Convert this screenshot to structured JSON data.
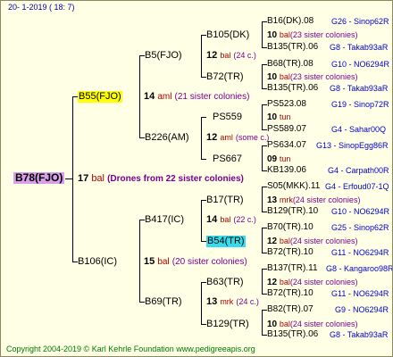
{
  "date_label": "20-   1-2019  (  18:   7)",
  "footer": "Copyright 2004-2019 © Karl Kehrle Foundation     www.pedigreeapis.org",
  "queen": {
    "id": "B78(FJO)",
    "value": "17",
    "unit": "bal",
    "note": "(Drones from 22 sister colonies)"
  },
  "sire": {
    "id": "B55(FJO)",
    "value": "14",
    "unit": "aml",
    "note": "(21 sister colonies)"
  },
  "dam": {
    "id": "B106(IC)",
    "value": "15",
    "unit": "bal",
    "note": "(20 sister colonies)"
  },
  "gen3": [
    {
      "id": "B5(FJO)",
      "value": "12",
      "unit": "bal",
      "note": "(24 c.)"
    },
    {
      "id": "B226(AM)",
      "value": "12",
      "unit": "aml",
      "note": "(some c.)"
    },
    {
      "id": "B417(IC)",
      "value": "14",
      "unit": "bal",
      "note": "(22 c.)"
    },
    {
      "id": "B69(TR)",
      "value": "13",
      "unit": "mrk",
      "note": "(24 c.)"
    }
  ],
  "gen4": [
    {
      "id": "B105(DK)",
      "value": "10",
      "unit": "bal",
      "note": "(23 sister colonies)"
    },
    {
      "id": "B72(TR)",
      "value": "10",
      "unit": "bal",
      "note": "(23 sister colonies)"
    },
    {
      "id": "PS559",
      "value": "10",
      "unit": "tun",
      "note": ""
    },
    {
      "id": "PS667",
      "value": "09",
      "unit": "tun",
      "note": ""
    },
    {
      "id": "B17(TR)",
      "value": "13",
      "unit": "mrk",
      "note": "(24 sister colonies)"
    },
    {
      "id": "B54(TR)",
      "value": "12",
      "unit": "bal",
      "note": "(24 sister colonies)"
    },
    {
      "id": "B63(TR)",
      "value": "12",
      "unit": "bal",
      "note": "(24 sister colonies)"
    },
    {
      "id": "B129(TR)",
      "value": "10",
      "unit": "bal",
      "note": "(24 sister colonies)"
    }
  ],
  "gen5": [
    {
      "id": "B16(DK).08",
      "link": "G26 - Sinop62R"
    },
    {
      "id": "B135(TR).06",
      "link": "G8 - Takab93aR"
    },
    {
      "id": "B68(TR).08",
      "link": "G10 - NO6294R"
    },
    {
      "id": "B135(TR).06",
      "link": "G8 - Takab93aR"
    },
    {
      "id": "PS523.08",
      "link": "G19 - Sinop72R"
    },
    {
      "id": "PS589.07",
      "link": "G4 - Sahar00Q"
    },
    {
      "id": "PS634.07",
      "link": "G13 - SinopEgg86R"
    },
    {
      "id": "KB139.06",
      "link": "G4 - Carpath00R"
    },
    {
      "id": "S05(MKK).11",
      "link": "G4 - Erfoud07-1Q"
    },
    {
      "id": "B129(TR).10",
      "link": "G10 - NO6294R"
    },
    {
      "id": "B70(TR).10",
      "link": "G25 - Sinop62R"
    },
    {
      "id": "B72(TR).10",
      "link": "G11 - NO6294R"
    },
    {
      "id": "B137(TR).11",
      "link": "G8 - Kangaroo98R"
    },
    {
      "id": "B72(TR).10",
      "link": "G11 - NO6294R"
    },
    {
      "id": "B82(TR).07",
      "link": "G9 - NO6294R"
    },
    {
      "id": "B135(TR).06",
      "link": "G8 - Takab93aR"
    }
  ]
}
